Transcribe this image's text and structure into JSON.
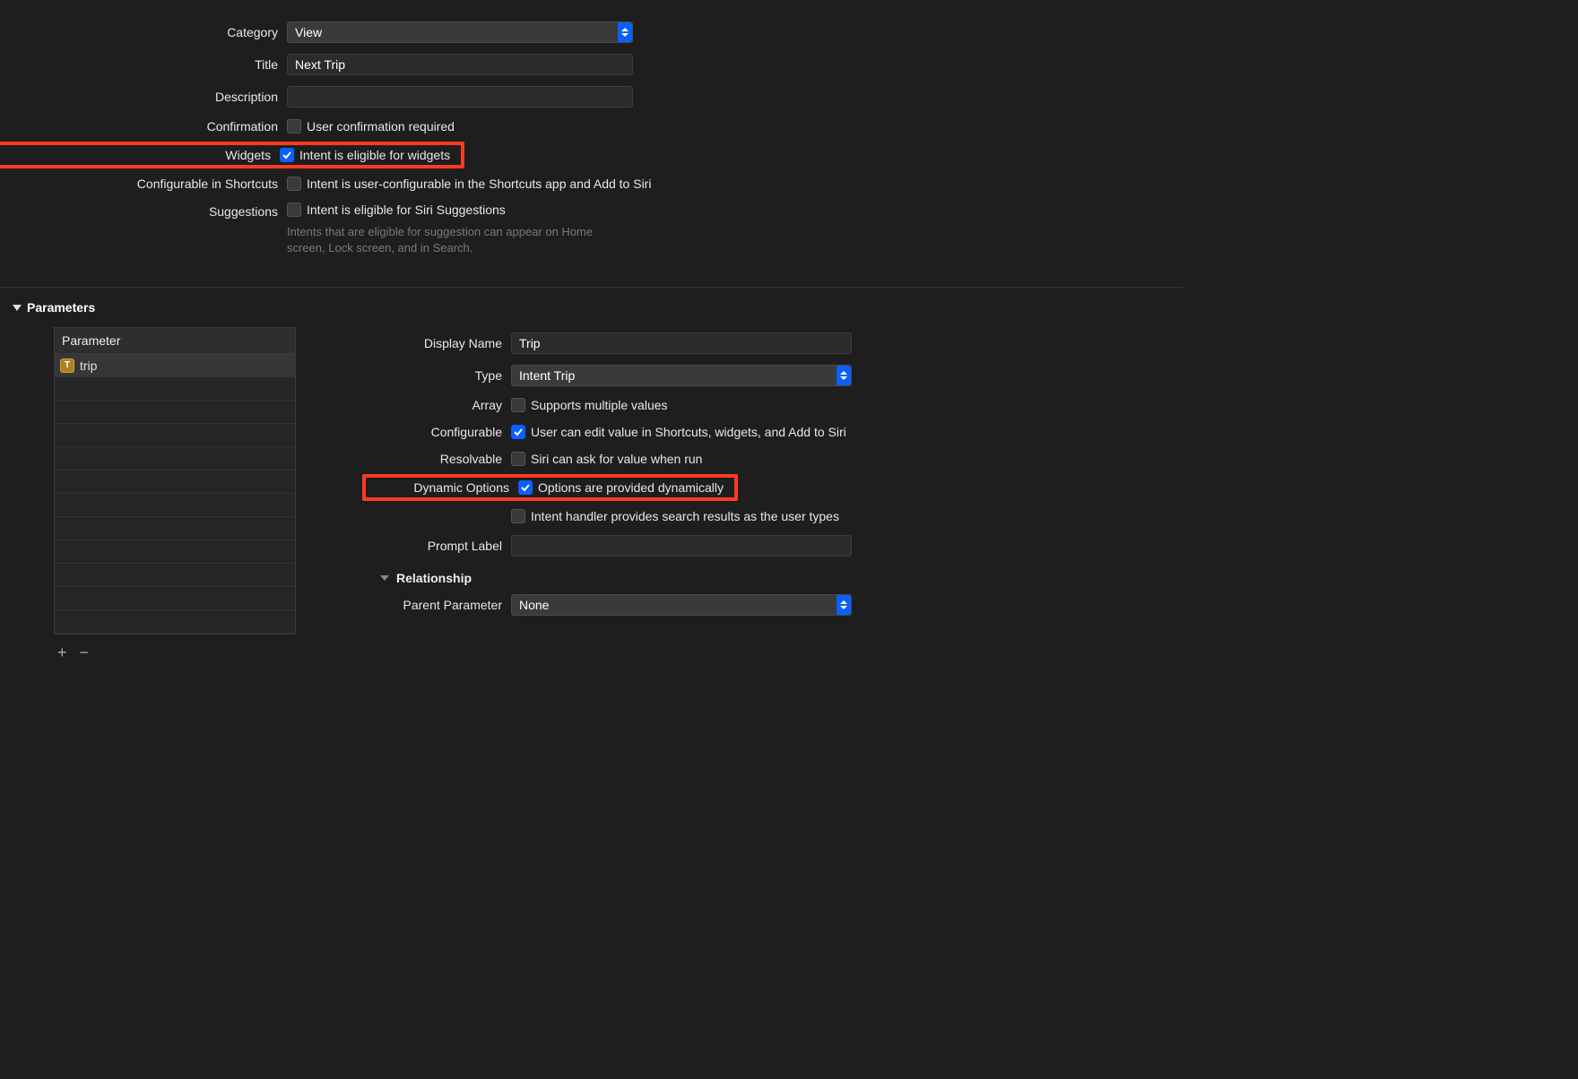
{
  "topForm": {
    "category": {
      "label": "Category",
      "value": "View"
    },
    "title": {
      "label": "Title",
      "value": "Next Trip"
    },
    "description": {
      "label": "Description",
      "value": ""
    },
    "confirmation": {
      "label": "Confirmation",
      "checkLabel": "User confirmation required",
      "checked": false
    },
    "widgets": {
      "label": "Widgets",
      "checkLabel": "Intent is eligible for widgets",
      "checked": true
    },
    "shortcuts": {
      "label": "Configurable in Shortcuts",
      "checkLabel": "Intent is user-configurable in the Shortcuts app and Add to Siri",
      "checked": false
    },
    "suggestions": {
      "label": "Suggestions",
      "checkLabel": "Intent is eligible for Siri Suggestions",
      "checked": false,
      "help": "Intents that are eligible for suggestion can appear on Home screen, Lock screen, and in Search."
    }
  },
  "parametersSection": {
    "header": "Parameters",
    "tableHeader": "Parameter",
    "rows": [
      {
        "name": "trip",
        "typeBadge": "T"
      }
    ],
    "addIcon": "+",
    "removeIcon": "−"
  },
  "paramDetail": {
    "displayName": {
      "label": "Display Name",
      "value": "Trip"
    },
    "type": {
      "label": "Type",
      "value": "Intent Trip"
    },
    "array": {
      "label": "Array",
      "checkLabel": "Supports multiple values",
      "checked": false
    },
    "configurable": {
      "label": "Configurable",
      "checkLabel": "User can edit value in Shortcuts, widgets, and Add to Siri",
      "checked": true
    },
    "resolvable": {
      "label": "Resolvable",
      "checkLabel": "Siri can ask for value when run",
      "checked": false
    },
    "dynamicOptions": {
      "label": "Dynamic Options",
      "checkLabel": "Options are provided dynamically",
      "checked": true
    },
    "searchResults": {
      "label": "",
      "checkLabel": "Intent handler provides search results as the user types",
      "checked": false
    },
    "promptLabel": {
      "label": "Prompt Label",
      "value": ""
    },
    "relationship": {
      "header": "Relationship"
    },
    "parentParam": {
      "label": "Parent Parameter",
      "value": "None"
    }
  }
}
